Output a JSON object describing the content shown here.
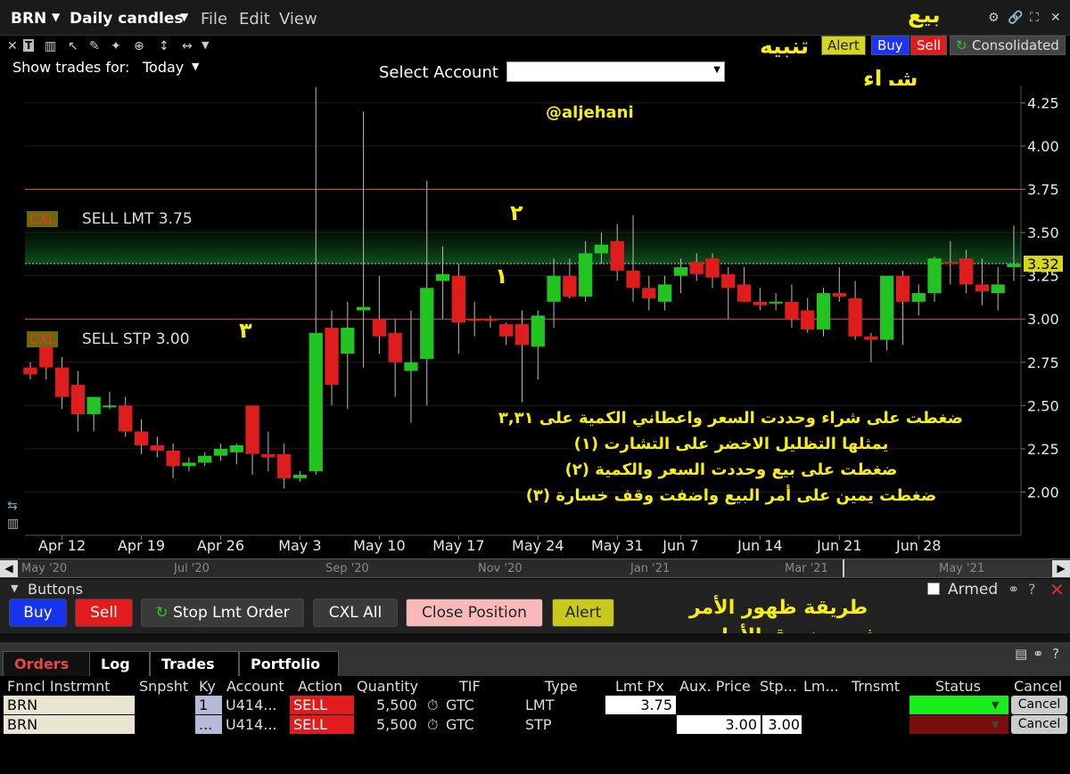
{
  "toolbar": {
    "symbol": "BRN",
    "period": "Daily candles",
    "menu": [
      "File",
      "Edit",
      "View"
    ],
    "show_trades_label": "Show trades for:",
    "show_trades_value": "Today",
    "select_account_label": "Select Account",
    "alert": "Alert",
    "buy": "Buy",
    "sell": "Sell",
    "consolidated": "Consolidated"
  },
  "annotations": {
    "sell_ar": "بيع",
    "alert_ar": "تنبيه",
    "buy_ar": "شراء",
    "handle": "@aljehani",
    "num1": "١",
    "num2": "٢",
    "num3": "٣",
    "note1": "ضغطت على شراء وحددت السعر واعطاني الكمية على ٣,٣١",
    "note2": "يمثلها التظليل الاخضر على التشارت (١)",
    "note3": "ضغطت على بيع وحددت السعر والكمية (٢)",
    "note4": "ضغطت يمين على أمر البيع واضفت وقف خسارة (٣)",
    "order_note1": "طريقة ظهور الأمر",
    "order_note2": "في صندوق الأوامر"
  },
  "chart_orders": {
    "cxl": "CXL",
    "lmt_label": "SELL LMT 3.75",
    "stp_label": "SELL STP 3.00"
  },
  "chart_data": {
    "type": "candlestick",
    "ylim": [
      1.75,
      4.35
    ],
    "y_ticks": [
      "4.25",
      "4.00",
      "3.75",
      "3.50",
      "3.25",
      "3.00",
      "2.75",
      "2.50",
      "2.25",
      "2.00"
    ],
    "x_ticks": [
      "Apr 12",
      "Apr 19",
      "Apr 26",
      "May 3",
      "May 10",
      "May 17",
      "May 24",
      "May 31",
      "Jun 7",
      "Jun 14",
      "Jun 21",
      "Jun 28"
    ],
    "last_price": "3.32",
    "sell_limit": 3.75,
    "sell_stop": 3.0,
    "candles": [
      [
        2.72,
        2.75,
        2.65,
        2.68
      ],
      [
        2.88,
        2.9,
        2.65,
        2.72
      ],
      [
        2.72,
        2.78,
        2.48,
        2.55
      ],
      [
        2.62,
        2.7,
        2.35,
        2.45
      ],
      [
        2.45,
        2.55,
        2.35,
        2.55
      ],
      [
        2.5,
        2.58,
        2.48,
        2.5
      ],
      [
        2.5,
        2.55,
        2.32,
        2.35
      ],
      [
        2.35,
        2.42,
        2.22,
        2.27
      ],
      [
        2.27,
        2.32,
        2.2,
        2.24
      ],
      [
        2.24,
        2.28,
        2.08,
        2.15
      ],
      [
        2.15,
        2.2,
        2.12,
        2.17
      ],
      [
        2.17,
        2.23,
        2.15,
        2.21
      ],
      [
        2.21,
        2.28,
        2.18,
        2.25
      ],
      [
        2.23,
        2.28,
        2.16,
        2.27
      ],
      [
        2.5,
        2.5,
        2.1,
        2.22
      ],
      [
        2.22,
        2.35,
        2.12,
        2.2
      ],
      [
        2.22,
        2.28,
        2.02,
        2.08
      ],
      [
        2.08,
        2.12,
        2.06,
        2.1
      ],
      [
        2.12,
        4.34,
        2.1,
        2.92
      ],
      [
        2.95,
        3.05,
        2.5,
        2.62
      ],
      [
        2.8,
        3.1,
        2.48,
        2.95
      ],
      [
        3.05,
        4.2,
        2.72,
        3.07
      ],
      [
        3.0,
        3.25,
        2.8,
        2.9
      ],
      [
        2.92,
        3.0,
        2.55,
        2.75
      ],
      [
        2.7,
        3.05,
        2.4,
        2.75
      ],
      [
        2.77,
        3.8,
        2.5,
        3.18
      ],
      [
        3.22,
        3.42,
        3.0,
        3.26
      ],
      [
        3.25,
        3.32,
        2.8,
        2.98
      ],
      [
        3.0,
        3.1,
        2.9,
        2.99
      ],
      [
        3.0,
        3.02,
        2.95,
        2.99
      ],
      [
        2.97,
        2.98,
        2.85,
        2.9
      ],
      [
        2.97,
        3.05,
        2.52,
        2.85
      ],
      [
        2.84,
        3.05,
        2.65,
        3.02
      ],
      [
        3.1,
        3.35,
        2.95,
        3.25
      ],
      [
        3.25,
        3.35,
        3.12,
        3.13
      ],
      [
        3.13,
        3.45,
        3.1,
        3.38
      ],
      [
        3.38,
        3.5,
        3.32,
        3.43
      ],
      [
        3.45,
        3.55,
        3.22,
        3.28
      ],
      [
        3.28,
        3.6,
        3.1,
        3.18
      ],
      [
        3.18,
        3.25,
        3.05,
        3.12
      ],
      [
        3.1,
        3.25,
        3.05,
        3.2
      ],
      [
        3.25,
        3.35,
        3.15,
        3.3
      ],
      [
        3.33,
        3.38,
        3.22,
        3.26
      ],
      [
        3.35,
        3.38,
        3.18,
        3.24
      ],
      [
        3.26,
        3.3,
        3.0,
        3.18
      ],
      [
        3.2,
        3.3,
        3.1,
        3.1
      ],
      [
        3.1,
        3.18,
        3.05,
        3.08
      ],
      [
        3.1,
        3.15,
        3.05,
        3.1
      ],
      [
        3.1,
        3.2,
        2.95,
        3.0
      ],
      [
        3.05,
        3.12,
        2.92,
        2.94
      ],
      [
        2.94,
        3.18,
        2.9,
        3.15
      ],
      [
        3.15,
        3.3,
        3.1,
        3.13
      ],
      [
        3.12,
        3.22,
        2.88,
        2.9
      ],
      [
        2.9,
        2.92,
        2.75,
        2.88
      ],
      [
        2.88,
        3.25,
        2.82,
        3.25
      ],
      [
        3.25,
        3.28,
        2.85,
        3.1
      ],
      [
        3.1,
        3.2,
        3.02,
        3.15
      ],
      [
        3.15,
        3.36,
        3.1,
        3.35
      ],
      [
        3.33,
        3.45,
        3.2,
        3.32
      ],
      [
        3.35,
        3.4,
        3.15,
        3.2
      ],
      [
        3.2,
        3.35,
        3.08,
        3.16
      ],
      [
        3.15,
        3.3,
        3.05,
        3.2
      ],
      [
        3.3,
        3.54,
        3.22,
        3.32
      ]
    ],
    "nav_labels": [
      "May '20",
      "Jul '20",
      "Sep '20",
      "Nov '20",
      "Jan '21",
      "Mar '21",
      "May '21"
    ]
  },
  "buttons_panel": {
    "title": "Buttons",
    "armed": "Armed",
    "buy": "Buy",
    "sell": "Sell",
    "stop_lmt": "Stop Lmt Order",
    "cxl_all": "CXL All",
    "close_position": "Close Position",
    "alert": "Alert"
  },
  "tabs": [
    "Orders",
    "Log",
    "Trades",
    "Portfolio"
  ],
  "orders": {
    "headers": [
      "Fnncl Instrmnt",
      "Snpsht",
      "Ky",
      "Account",
      "Action",
      "Quantity",
      "TIF",
      "Type",
      "Lmt Px",
      "Aux. Price",
      "Stp...",
      "Lm...",
      "Trnsmt",
      "Status",
      "Cancel"
    ],
    "rows": [
      {
        "instrument": "BRN",
        "ky": "1",
        "account": "U414...",
        "action": "SELL",
        "quantity": "5,500",
        "tif": "GTC",
        "type": "LMT",
        "lmt_px": "3.75",
        "aux": "",
        "stp": "",
        "cancel": "Cancel"
      },
      {
        "instrument": "BRN",
        "ky": "...",
        "account": "U414...",
        "action": "SELL",
        "quantity": "5,500",
        "tif": "GTC",
        "type": "STP",
        "lmt_px": "",
        "aux": "3.00",
        "stp": "3.00",
        "cancel": "Cancel"
      }
    ]
  },
  "colors": {
    "up": "#21c421",
    "down": "#e01d1d",
    "annotation": "#f6ee16"
  }
}
